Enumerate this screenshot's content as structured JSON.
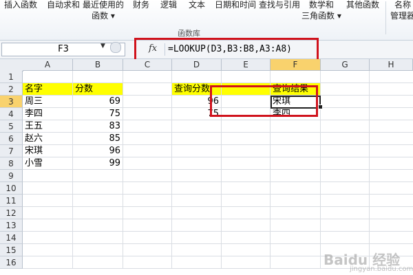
{
  "ribbon": {
    "buttons": [
      {
        "line1": "插入函数",
        "line2": ""
      },
      {
        "line1": "自动求和",
        "line2": ""
      },
      {
        "line1": "最近使用的",
        "line2": "函数 ▾"
      },
      {
        "line1": "财务",
        "line2": ""
      },
      {
        "line1": "逻辑",
        "line2": ""
      },
      {
        "line1": "文本",
        "line2": ""
      },
      {
        "line1": "日期和时间",
        "line2": ""
      },
      {
        "line1": "查找与引用",
        "line2": ""
      },
      {
        "line1": "数学和",
        "line2": "三角函数 ▾"
      },
      {
        "line1": "其他函数",
        "line2": ""
      },
      {
        "line1": "名称",
        "line2": "管理器"
      }
    ],
    "group_label": "函数库"
  },
  "formula_bar": {
    "name_box": "F3",
    "fx_label": "fx",
    "formula": "=LOOKUP(D3,B3:B8,A3:A8)"
  },
  "columns": [
    "A",
    "B",
    "C",
    "D",
    "E",
    "F",
    "G",
    "H"
  ],
  "selected_column": "F",
  "rows": [
    "1",
    "2",
    "3",
    "4",
    "5",
    "6",
    "7",
    "8",
    "9",
    "10",
    "11",
    "12",
    "13",
    "14",
    "15",
    "16"
  ],
  "selected_row": "3",
  "cells": {
    "A2": "名字",
    "B2": "分数",
    "A3": "周三",
    "B3": "69",
    "A4": "李四",
    "B4": "75",
    "A5": "王五",
    "B5": "83",
    "A6": "赵六",
    "B6": "85",
    "A7": "宋琪",
    "B7": "96",
    "A8": "小雪",
    "B8": "99",
    "D2": "查询分数",
    "F2": "查询结果",
    "D3": "96",
    "F3": "宋琪",
    "D4": "75",
    "F4": "李四"
  },
  "watermark": {
    "text": "Baidu 经验",
    "sub": "jingyan.baidu.com"
  },
  "colors": {
    "highlight_red": "#d0121c",
    "header_yellow": "#ffff00",
    "selected_header": "#f9d26d"
  }
}
